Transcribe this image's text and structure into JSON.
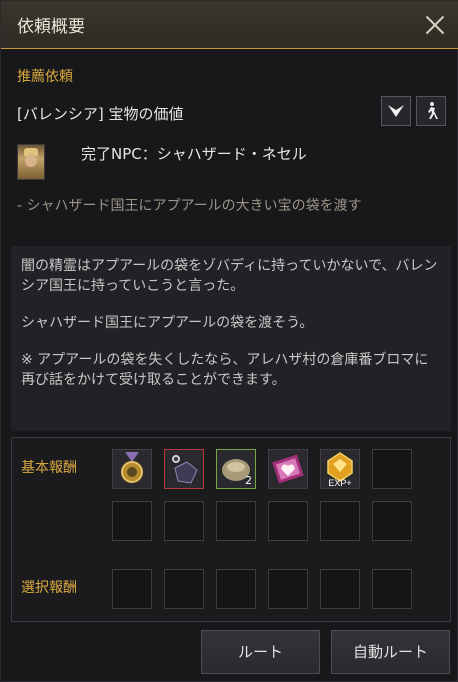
{
  "window": {
    "title": "依頼概要"
  },
  "quest": {
    "section_label": "推薦依頼",
    "name": "[バレンシア] 宝物の価値",
    "npc_text": "完了NPC：シャハザード・ネセル",
    "objective": "- シャハザード国王にアプアールの大きい宝の袋を渡す",
    "description": [
      "闇の精霊はアプアールの袋をゾバディに持っていかないで、バレンシア国王に持っていこうと言った。",
      "シャハザード国王にアプアールの袋を渡そう。",
      "※ アプアールの袋を失くしたなら、アレハザ村の倉庫番ブロマに再び話をかけて受け取ることができます。"
    ]
  },
  "rewards": {
    "basic_label": "基本報酬",
    "select_label": "選択報酬",
    "basic_items": [
      {
        "icon": "medal-icon",
        "border": "normal"
      },
      {
        "icon": "black-stone-icon",
        "border": "red"
      },
      {
        "icon": "coin-pouch-icon",
        "border": "green",
        "count": "2"
      },
      {
        "icon": "pink-scroll-icon",
        "border": "normal"
      },
      {
        "icon": "exp-gem-icon",
        "border": "normal",
        "label": "EXP+"
      }
    ]
  },
  "buttons": {
    "route": "ルート",
    "auto_route": "自動ルート"
  },
  "colors": {
    "accent": "#d8a93e",
    "title_border": "#c79a3a"
  }
}
